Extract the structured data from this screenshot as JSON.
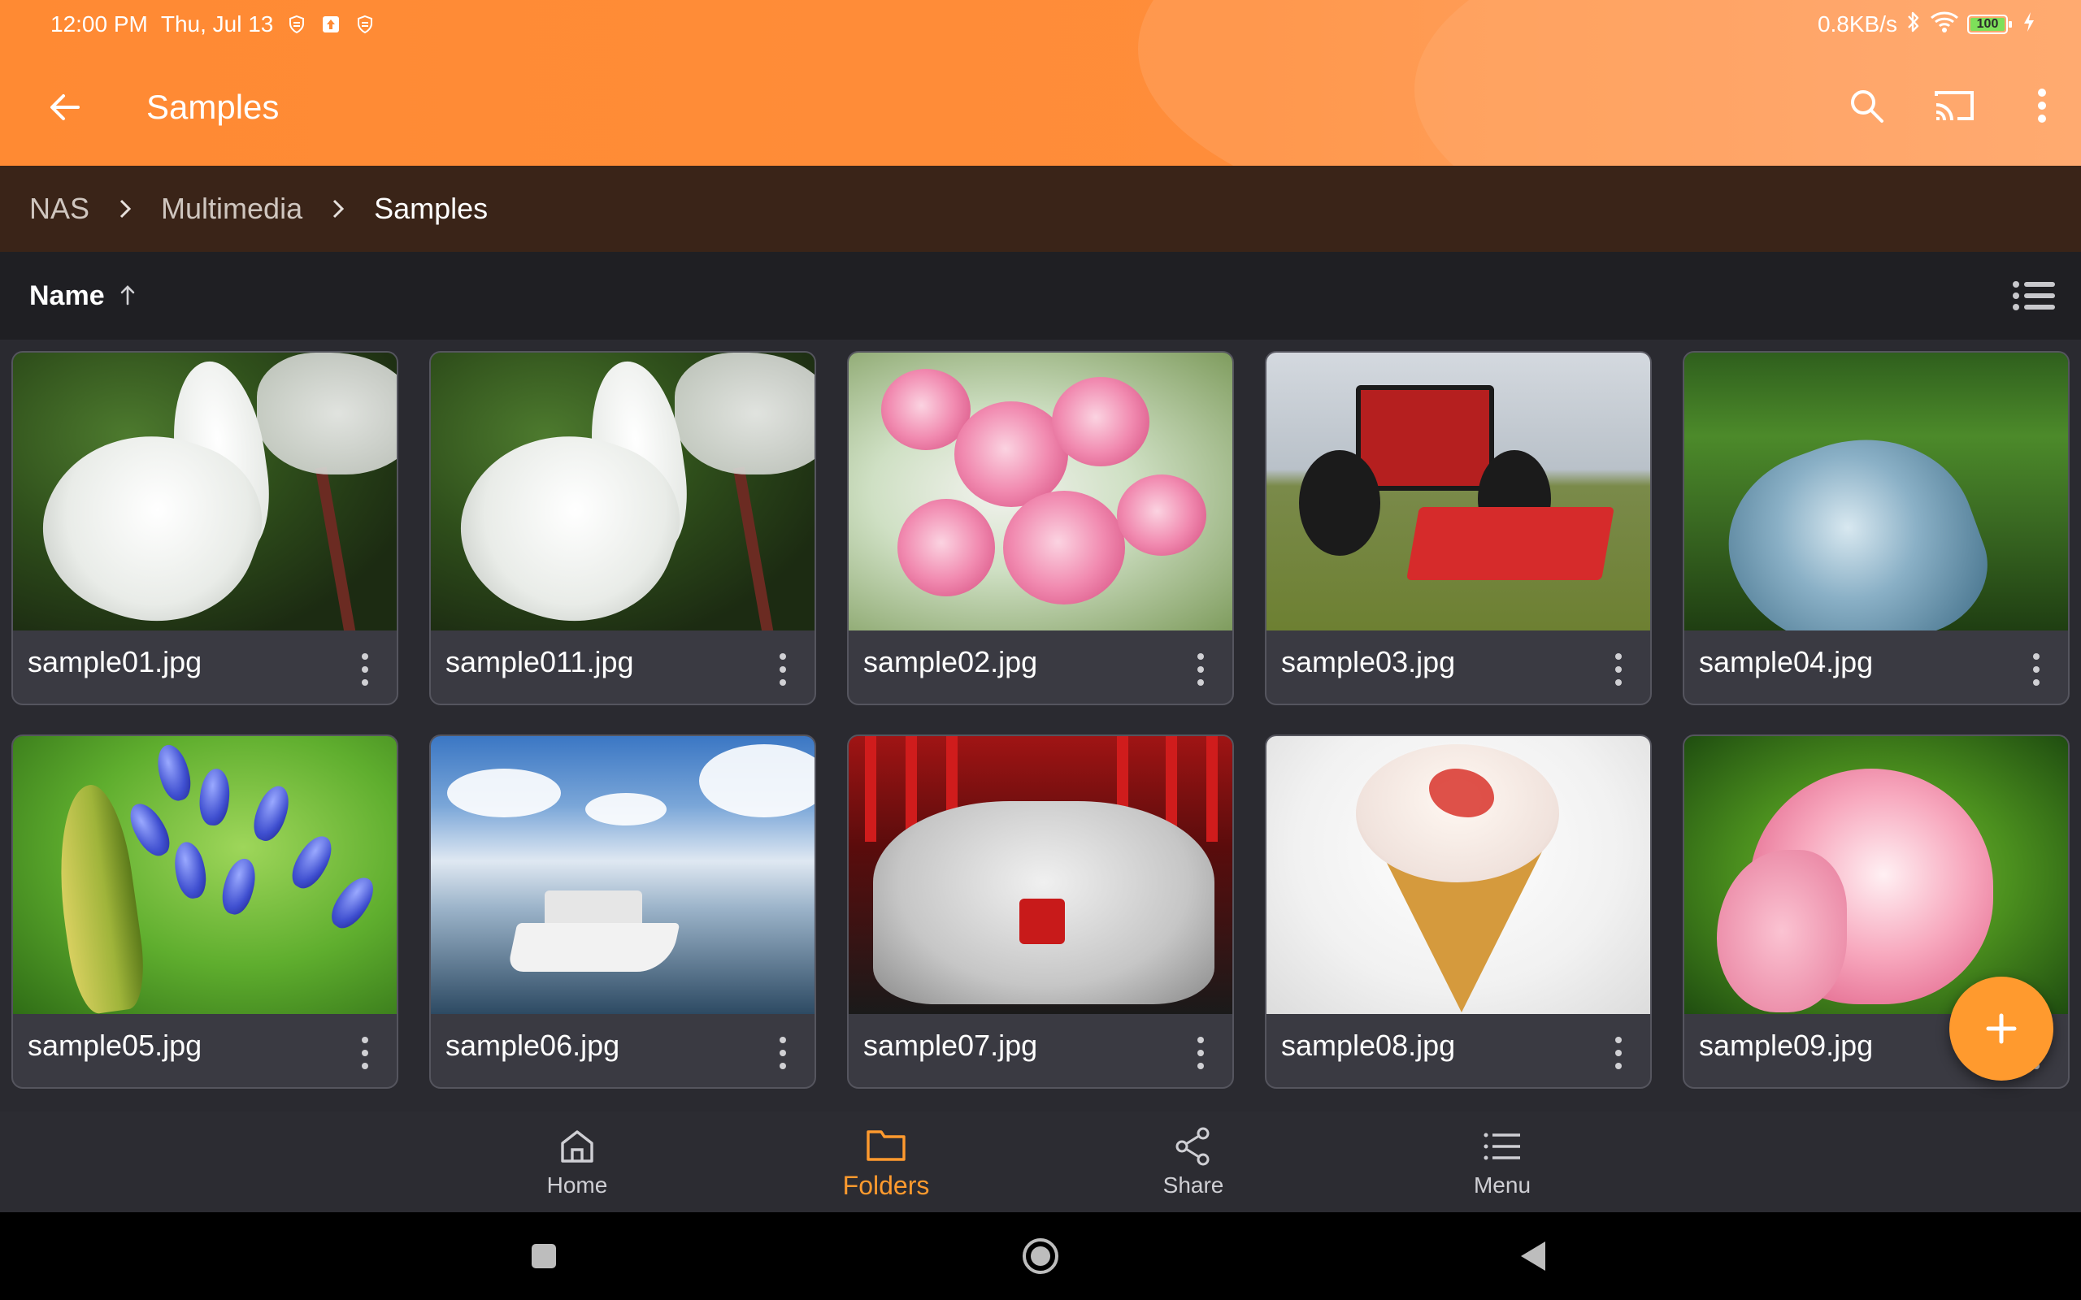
{
  "status_bar": {
    "time": "12:00 PM",
    "date": "Thu, Jul 13",
    "speed": "0.8KB/s",
    "battery_level": "100",
    "icons_left": [
      "shield-icon",
      "upload-icon",
      "shield-icon"
    ],
    "icons_right": [
      "bluetooth-icon",
      "wifi-icon",
      "battery-icon",
      "charging-icon"
    ]
  },
  "app_bar": {
    "title": "Samples",
    "background_color": "#ff8a33",
    "actions": [
      "search-icon",
      "cast-icon",
      "more-vert-icon"
    ]
  },
  "breadcrumb": {
    "items": [
      {
        "label": "NAS"
      },
      {
        "label": "Multimedia"
      },
      {
        "label": "Samples"
      }
    ]
  },
  "sort": {
    "label": "Name",
    "direction": "ascending"
  },
  "files": [
    {
      "name": "sample01.jpg"
    },
    {
      "name": "sample011.jpg"
    },
    {
      "name": "sample02.jpg"
    },
    {
      "name": "sample03.jpg"
    },
    {
      "name": "sample04.jpg"
    },
    {
      "name": "sample05.jpg"
    },
    {
      "name": "sample06.jpg"
    },
    {
      "name": "sample07.jpg"
    },
    {
      "name": "sample08.jpg"
    },
    {
      "name": "sample09.jpg"
    }
  ],
  "bottom_nav": {
    "items": [
      {
        "label": "Home",
        "icon": "home-icon"
      },
      {
        "label": "Folders",
        "icon": "folder-icon",
        "active": true
      },
      {
        "label": "Share",
        "icon": "share-icon"
      },
      {
        "label": "Menu",
        "icon": "menu-icon"
      }
    ],
    "active_color": "#ff9a2e"
  },
  "fab": {
    "icon": "plus-icon",
    "color": "#ff9a2e"
  },
  "system_nav": [
    "recents-icon",
    "home-circle-icon",
    "back-triangle-icon"
  ]
}
